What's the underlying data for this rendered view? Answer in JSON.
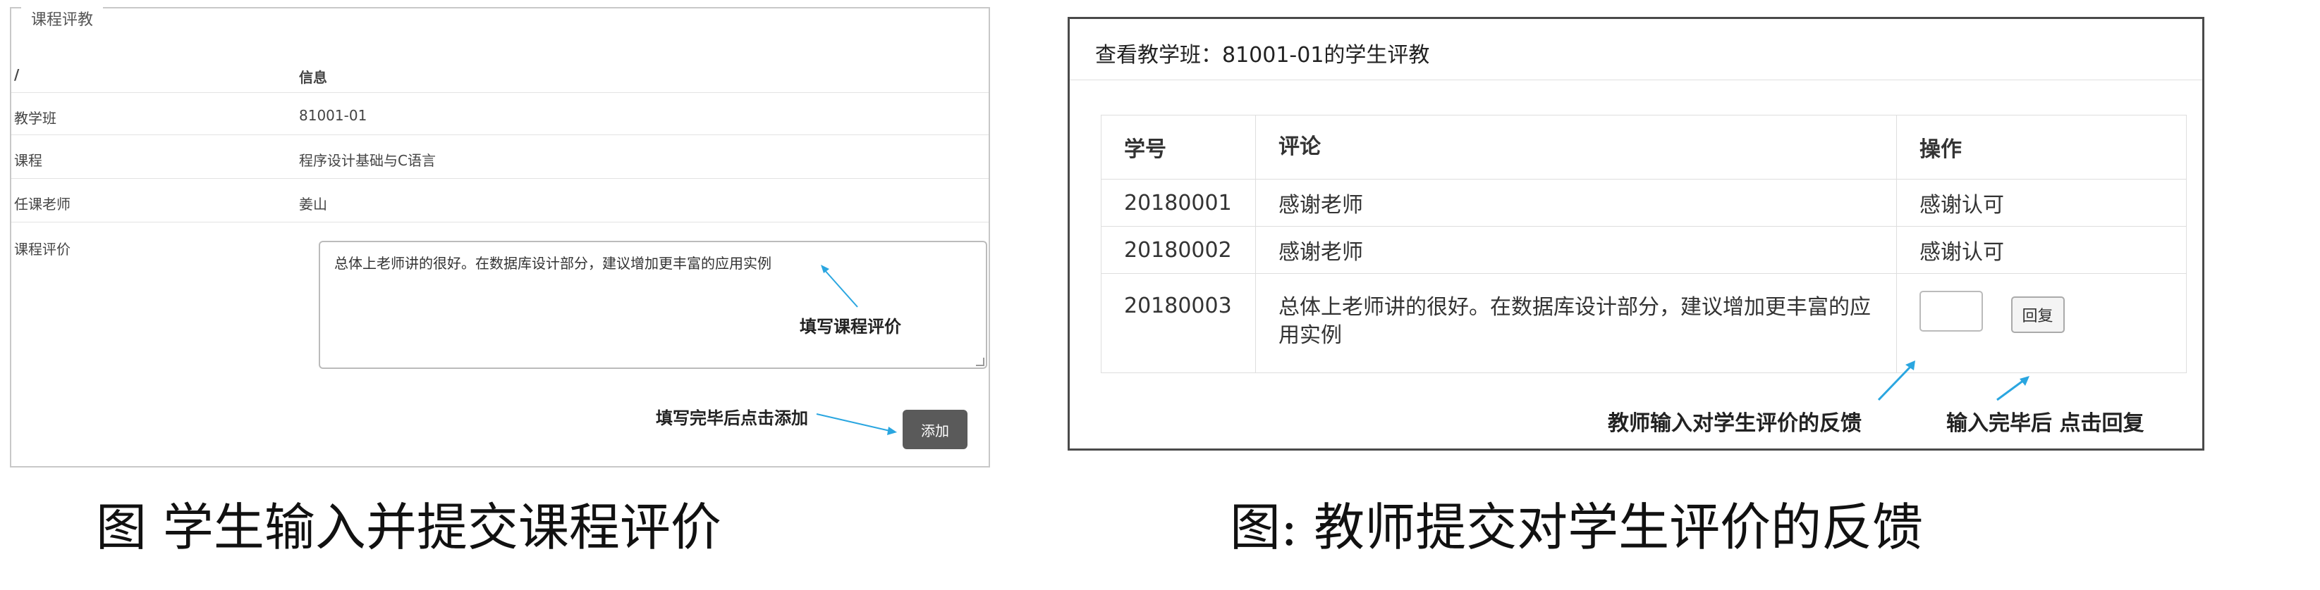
{
  "left": {
    "panel_title": "课程评教",
    "header": {
      "col1": "/",
      "col2": "信息"
    },
    "rows": [
      {
        "label": "教学班",
        "value": "81001-01"
      },
      {
        "label": "课程",
        "value": "程序设计基础与C语言"
      },
      {
        "label": "任课老师",
        "value": "姜山"
      }
    ],
    "eval_label": "课程评价",
    "eval_text": "总体上老师讲的很好。在数据库设计部分，建议增加更丰富的应用实例",
    "annotation_fill": "填写课程评价",
    "annotation_add": "填写完毕后点击添加",
    "add_button": "添加"
  },
  "right": {
    "title": "查看教学班：81001-01的学生评教",
    "columns": [
      "学号",
      "评论",
      "操作"
    ],
    "rows": [
      {
        "id": "20180001",
        "comment": "感谢老师",
        "action": "感谢认可"
      },
      {
        "id": "20180002",
        "comment": "感谢老师",
        "action": "感谢认可"
      },
      {
        "id": "20180003",
        "comment": "总体上老师讲的很好。在数据库设计部分，建议增加更丰富的应用实例",
        "action": ""
      }
    ],
    "reply_button": "回复",
    "annotation_teacher": "教师输入对学生评价的反馈",
    "annotation_reply": "输入完毕后 点击回复"
  },
  "captions": {
    "left": "图 学生输入并提交课程评价",
    "right": "图: 教师提交对学生评价的反馈"
  },
  "colors": {
    "annotation_arrow": "#2aa6e0",
    "add_button_bg": "#5a5a5a"
  }
}
